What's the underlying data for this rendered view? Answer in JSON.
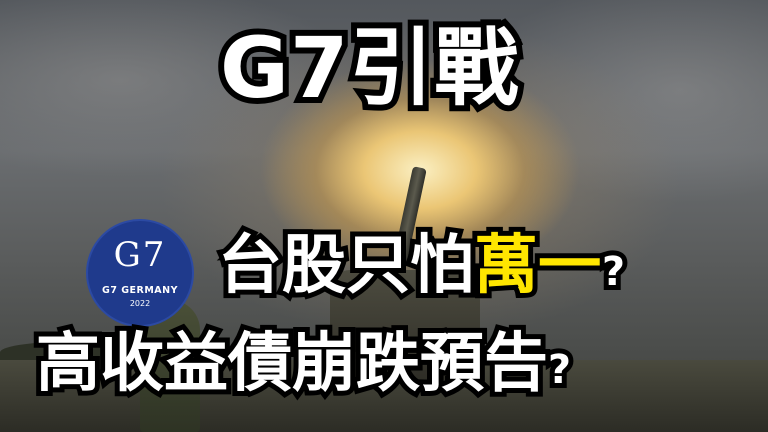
{
  "headline": {
    "top": "G7引戰",
    "middle_prefix": "台股只怕",
    "middle_highlight": "萬一",
    "middle_suffix": "?",
    "bottom": "高收益債崩跌預告",
    "bottom_suffix": "?"
  },
  "logo": {
    "mark": "G7",
    "name": "G7 GERMANY",
    "year": "2022"
  },
  "colors": {
    "headline_text": "#ffffff",
    "headline_outline": "#000000",
    "highlight_text": "#ffe600",
    "logo_background": "#1f3a8c"
  }
}
